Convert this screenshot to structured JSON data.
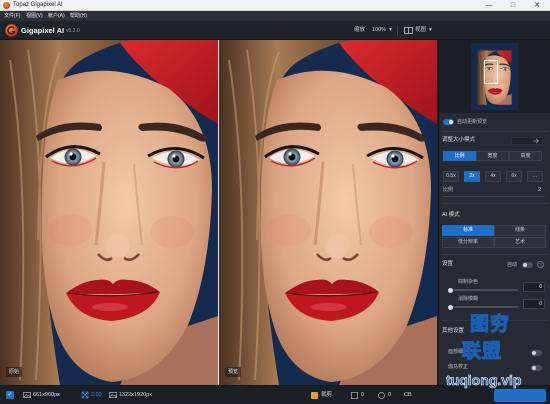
{
  "window": {
    "title": "Topaz Gigapixel AI",
    "controls": [
      "—",
      "□",
      "✕"
    ]
  },
  "menu": [
    "文件(F)",
    "视图(V)",
    "帐户(A)",
    "帮助(H)"
  ],
  "header": {
    "app_name": "Gigapixel AI",
    "version": "v5.3.0",
    "zoom_label": "缩放",
    "zoom_value": "100%",
    "view_label": "视图",
    "dropdown_glyph": "▾"
  },
  "preview": {
    "left_label": "原始",
    "right_label": "预览"
  },
  "panel": {
    "auto_preview": {
      "label": "自动更新预览",
      "on": true
    },
    "resize": {
      "title": "调整大小模式",
      "tabs": [
        "比例",
        "宽度",
        "高度"
      ],
      "selected_tab_index": 0,
      "scales": [
        "0.5x",
        "2x",
        "4x",
        "6x",
        "…"
      ],
      "selected_scale_index": 1,
      "scale_label": "比例",
      "scale_value": "2"
    },
    "ai_mode": {
      "title": "AI 模式",
      "modes": [
        "标准",
        "线条",
        "低分辨率",
        "艺术"
      ],
      "selected_index": 0
    },
    "settings": {
      "title": "设置",
      "auto_label": "自动",
      "auto_on": false,
      "noise": {
        "label": "抑制杂色",
        "value": "0"
      },
      "blur": {
        "label": "消除模糊",
        "value": "0"
      }
    },
    "other": {
      "title": "其他设置",
      "items": [
        "面部细化",
        "伽马校正"
      ]
    }
  },
  "status": {
    "checked_glyph": "✓",
    "input_size": "661x960px",
    "scale": "2.00",
    "output_size": "1322x1920px",
    "crop_label": "裁剪",
    "count_a": "0",
    "count_b": "0",
    "color_label": "CB"
  },
  "watermark": {
    "line1": "图穷",
    "line2": "联盟",
    "url": "tuqiong.vip"
  },
  "colors": {
    "accent": "#1f6fc8",
    "background": "#1d2128",
    "panel": "#262b33",
    "hat_red": "#c91e26"
  }
}
